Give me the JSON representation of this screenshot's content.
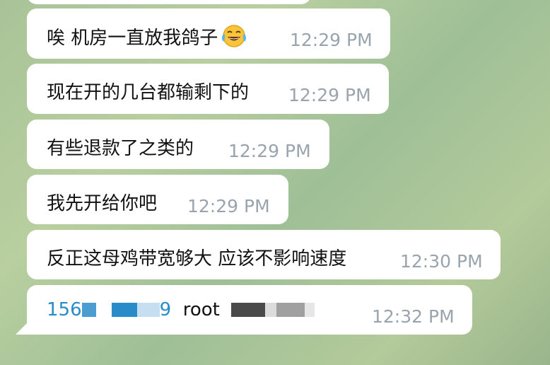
{
  "messages": [
    {
      "text": "唉  机房一直放我鸽子",
      "emoji": "face-with-tears-of-joy",
      "time": "12:29 PM"
    },
    {
      "text": "现在开的几台都输剩下的",
      "time": "12:29 PM"
    },
    {
      "text": "有些退款了之类的",
      "time": "12:29 PM"
    },
    {
      "text": "我先开给你吧",
      "time": "12:29 PM"
    },
    {
      "text": "反正这母鸡带宽够大  应该不影响速度",
      "time": "12:30 PM"
    },
    {
      "ip_prefix": "156",
      "ip_suffix": "9",
      "user": "root",
      "time": "12:32 PM"
    }
  ],
  "colors": {
    "link": "#2a8bc9",
    "time": "#9aa4ad",
    "redaction_dark": "#4a4a4a",
    "redaction_blue": "#2a8bc9",
    "redaction_gray": "#a0a0a0"
  }
}
